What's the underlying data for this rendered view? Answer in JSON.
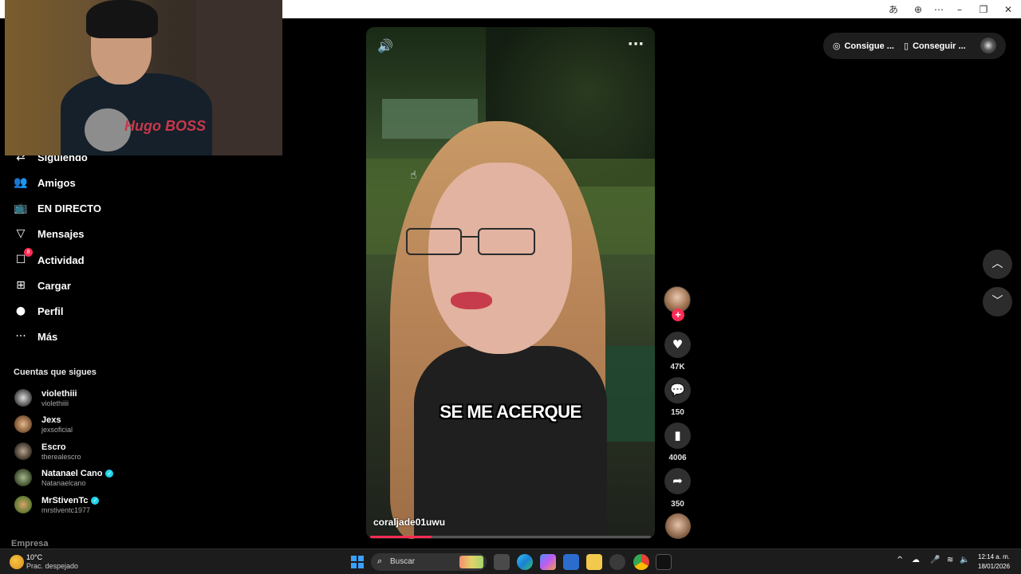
{
  "titlebar": {
    "icons": [
      "translate-icon",
      "zoom-icon",
      "more-icon",
      "minimize-icon",
      "restore-icon",
      "close-icon"
    ]
  },
  "webcam": {
    "shirt_text": "Hugo BOSS"
  },
  "sidebar": {
    "items": [
      {
        "label": "Siguiendo",
        "icon": "following-icon"
      },
      {
        "label": "Amigos",
        "icon": "friends-icon"
      },
      {
        "label": "EN DIRECTO",
        "icon": "live-icon"
      },
      {
        "label": "Mensajes",
        "icon": "messages-icon"
      },
      {
        "label": "Actividad",
        "icon": "activity-icon",
        "badge": "8"
      },
      {
        "label": "Cargar",
        "icon": "upload-icon"
      },
      {
        "label": "Perfil",
        "icon": "profile-icon"
      },
      {
        "label": "Más",
        "icon": "more-icon"
      }
    ],
    "following_title": "Cuentas que sigues",
    "following": [
      {
        "name": "violethiii",
        "username": "violethiiii",
        "verified": false
      },
      {
        "name": "Jexs",
        "username": "jexsoficial",
        "verified": false
      },
      {
        "name": "Escro",
        "username": "therealescro",
        "verified": false
      },
      {
        "name": "Natanael Cano",
        "username": "Natanaelcano",
        "verified": true
      },
      {
        "name": "MrStivenTc",
        "username": "mrstiventc1977",
        "verified": true
      }
    ],
    "footer_link": "Empresa"
  },
  "video": {
    "caption": "SE ME ACERQUE",
    "author": "coraljade01uwu",
    "progress": 0.22
  },
  "actions": {
    "likes": "47K",
    "comments": "150",
    "saves": "4006",
    "shares": "350"
  },
  "top_actions": {
    "coins": "Consigue ...",
    "app": "Conseguir ..."
  },
  "taskbar": {
    "weather_temp": "10°C",
    "weather_desc": "Prac. despejado",
    "search_label": "Buscar",
    "time": "12:14 a. m.",
    "date": "18/01/2026"
  },
  "colors": {
    "accent": "#fe2c55",
    "verified": "#20d5ec",
    "background": "#000000"
  }
}
